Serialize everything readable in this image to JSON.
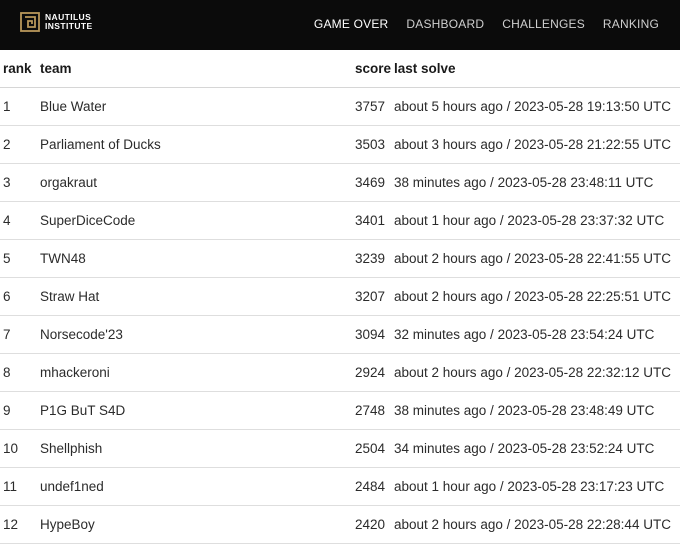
{
  "brand": {
    "line1": "NAUTILUS",
    "line2": "INSTITUTE",
    "logo_icon": "nautilus-square-logo-icon"
  },
  "nav": {
    "items": [
      {
        "label": "GAME OVER",
        "active": true
      },
      {
        "label": "DASHBOARD",
        "active": false
      },
      {
        "label": "CHALLENGES",
        "active": false
      },
      {
        "label": "RANKING",
        "active": false
      }
    ]
  },
  "table": {
    "headers": {
      "rank": "rank",
      "team": "team",
      "score": "score",
      "last_solve": "last solve"
    },
    "rows": [
      {
        "rank": "1",
        "team": "Blue Water",
        "score": "3757",
        "last_solve": "about 5 hours ago / 2023-05-28 19:13:50 UTC"
      },
      {
        "rank": "2",
        "team": "Parliament of Ducks",
        "score": "3503",
        "last_solve": "about 3 hours ago / 2023-05-28 21:22:55 UTC"
      },
      {
        "rank": "3",
        "team": "orgakraut",
        "score": "3469",
        "last_solve": "38 minutes ago / 2023-05-28 23:48:11 UTC"
      },
      {
        "rank": "4",
        "team": "SuperDiceCode",
        "score": "3401",
        "last_solve": "about 1 hour ago / 2023-05-28 23:37:32 UTC"
      },
      {
        "rank": "5",
        "team": "TWN48",
        "score": "3239",
        "last_solve": "about 2 hours ago / 2023-05-28 22:41:55 UTC"
      },
      {
        "rank": "6",
        "team": "Straw Hat",
        "score": "3207",
        "last_solve": "about 2 hours ago / 2023-05-28 22:25:51 UTC"
      },
      {
        "rank": "7",
        "team": "Norsecode'23",
        "score": "3094",
        "last_solve": "32 minutes ago / 2023-05-28 23:54:24 UTC"
      },
      {
        "rank": "8",
        "team": "mhackeroni",
        "score": "2924",
        "last_solve": "about 2 hours ago / 2023-05-28 22:32:12 UTC"
      },
      {
        "rank": "9",
        "team": "P1G BuT S4D",
        "score": "2748",
        "last_solve": "38 minutes ago / 2023-05-28 23:48:49 UTC"
      },
      {
        "rank": "10",
        "team": "Shellphish",
        "score": "2504",
        "last_solve": "34 minutes ago / 2023-05-28 23:52:24 UTC"
      },
      {
        "rank": "11",
        "team": "undef1ned",
        "score": "2484",
        "last_solve": "about 1 hour ago / 2023-05-28 23:17:23 UTC"
      },
      {
        "rank": "12",
        "team": "HypeBoy",
        "score": "2420",
        "last_solve": "about 2 hours ago / 2023-05-28 22:28:44 UTC"
      }
    ]
  },
  "colors": {
    "navbar_bg": "#0b0b0b",
    "logo_gold": "#b8975a",
    "nav_text": "#cfcfcf",
    "nav_active": "#ffffff",
    "row_border": "#dedede"
  }
}
